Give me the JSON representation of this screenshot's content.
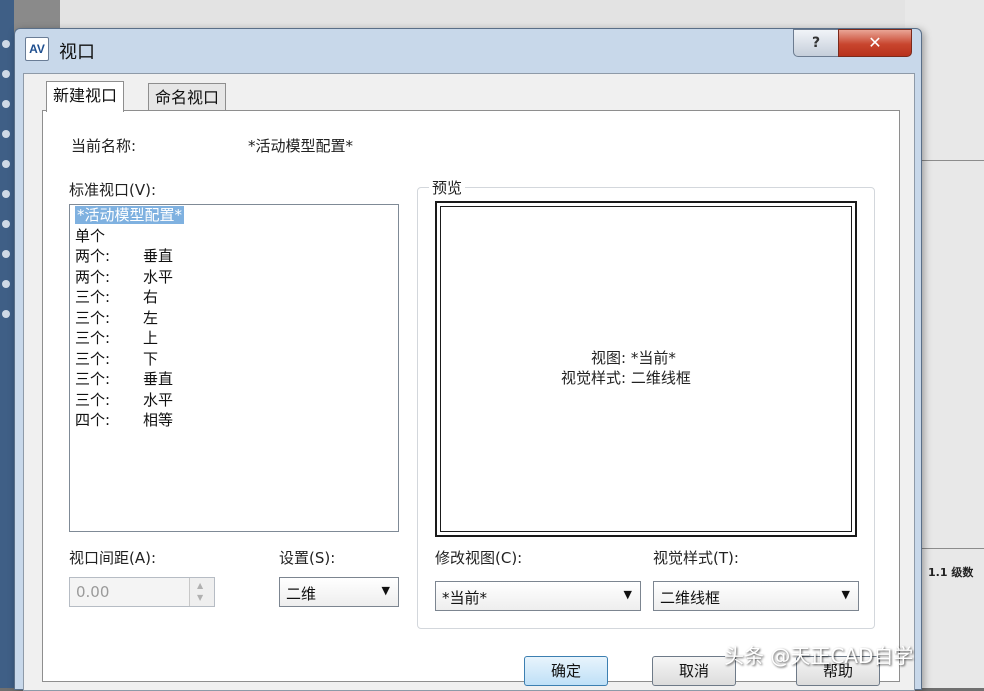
{
  "window": {
    "title": "视口",
    "icon_text": "AV",
    "help_symbol": "?",
    "close_symbol": "✕"
  },
  "tabs": [
    {
      "label": "新建视口",
      "active": true
    },
    {
      "label": "命名视口",
      "active": false
    }
  ],
  "current_name": {
    "label": "当前名称:",
    "value": "*活动模型配置*"
  },
  "standard_viewports": {
    "label": "标准视口(V):",
    "items": [
      {
        "a": "*活动模型配置*",
        "b": "",
        "selected": true
      },
      {
        "a": "单个",
        "b": ""
      },
      {
        "a": "两个:",
        "b": "垂直"
      },
      {
        "a": "两个:",
        "b": "水平"
      },
      {
        "a": "三个:",
        "b": "右"
      },
      {
        "a": "三个:",
        "b": "左"
      },
      {
        "a": "三个:",
        "b": "上"
      },
      {
        "a": "三个:",
        "b": "下"
      },
      {
        "a": "三个:",
        "b": "垂直"
      },
      {
        "a": "三个:",
        "b": "水平"
      },
      {
        "a": "四个:",
        "b": "相等"
      }
    ]
  },
  "viewport_spacing": {
    "label": "视口间距(A):",
    "value": "0.00"
  },
  "setup": {
    "label": "设置(S):",
    "value": "二维"
  },
  "preview": {
    "label": "预览",
    "view_text": "视图: *当前*",
    "visual_style_text": "视觉样式: 二维线框"
  },
  "modify_view": {
    "label": "修改视图(C):",
    "value": "*当前*"
  },
  "visual_style": {
    "label": "视觉样式(T):",
    "value": "二维线框"
  },
  "buttons": {
    "ok": "确定",
    "cancel": "取消",
    "help": "帮助"
  },
  "background": {
    "status_text": "1.1 级数"
  },
  "watermark": "头条 @天正CAD自学",
  "colors": {
    "selection": "#7fb1e0",
    "close_button": "#c8452e",
    "title_bar": "#c8d8ea"
  }
}
